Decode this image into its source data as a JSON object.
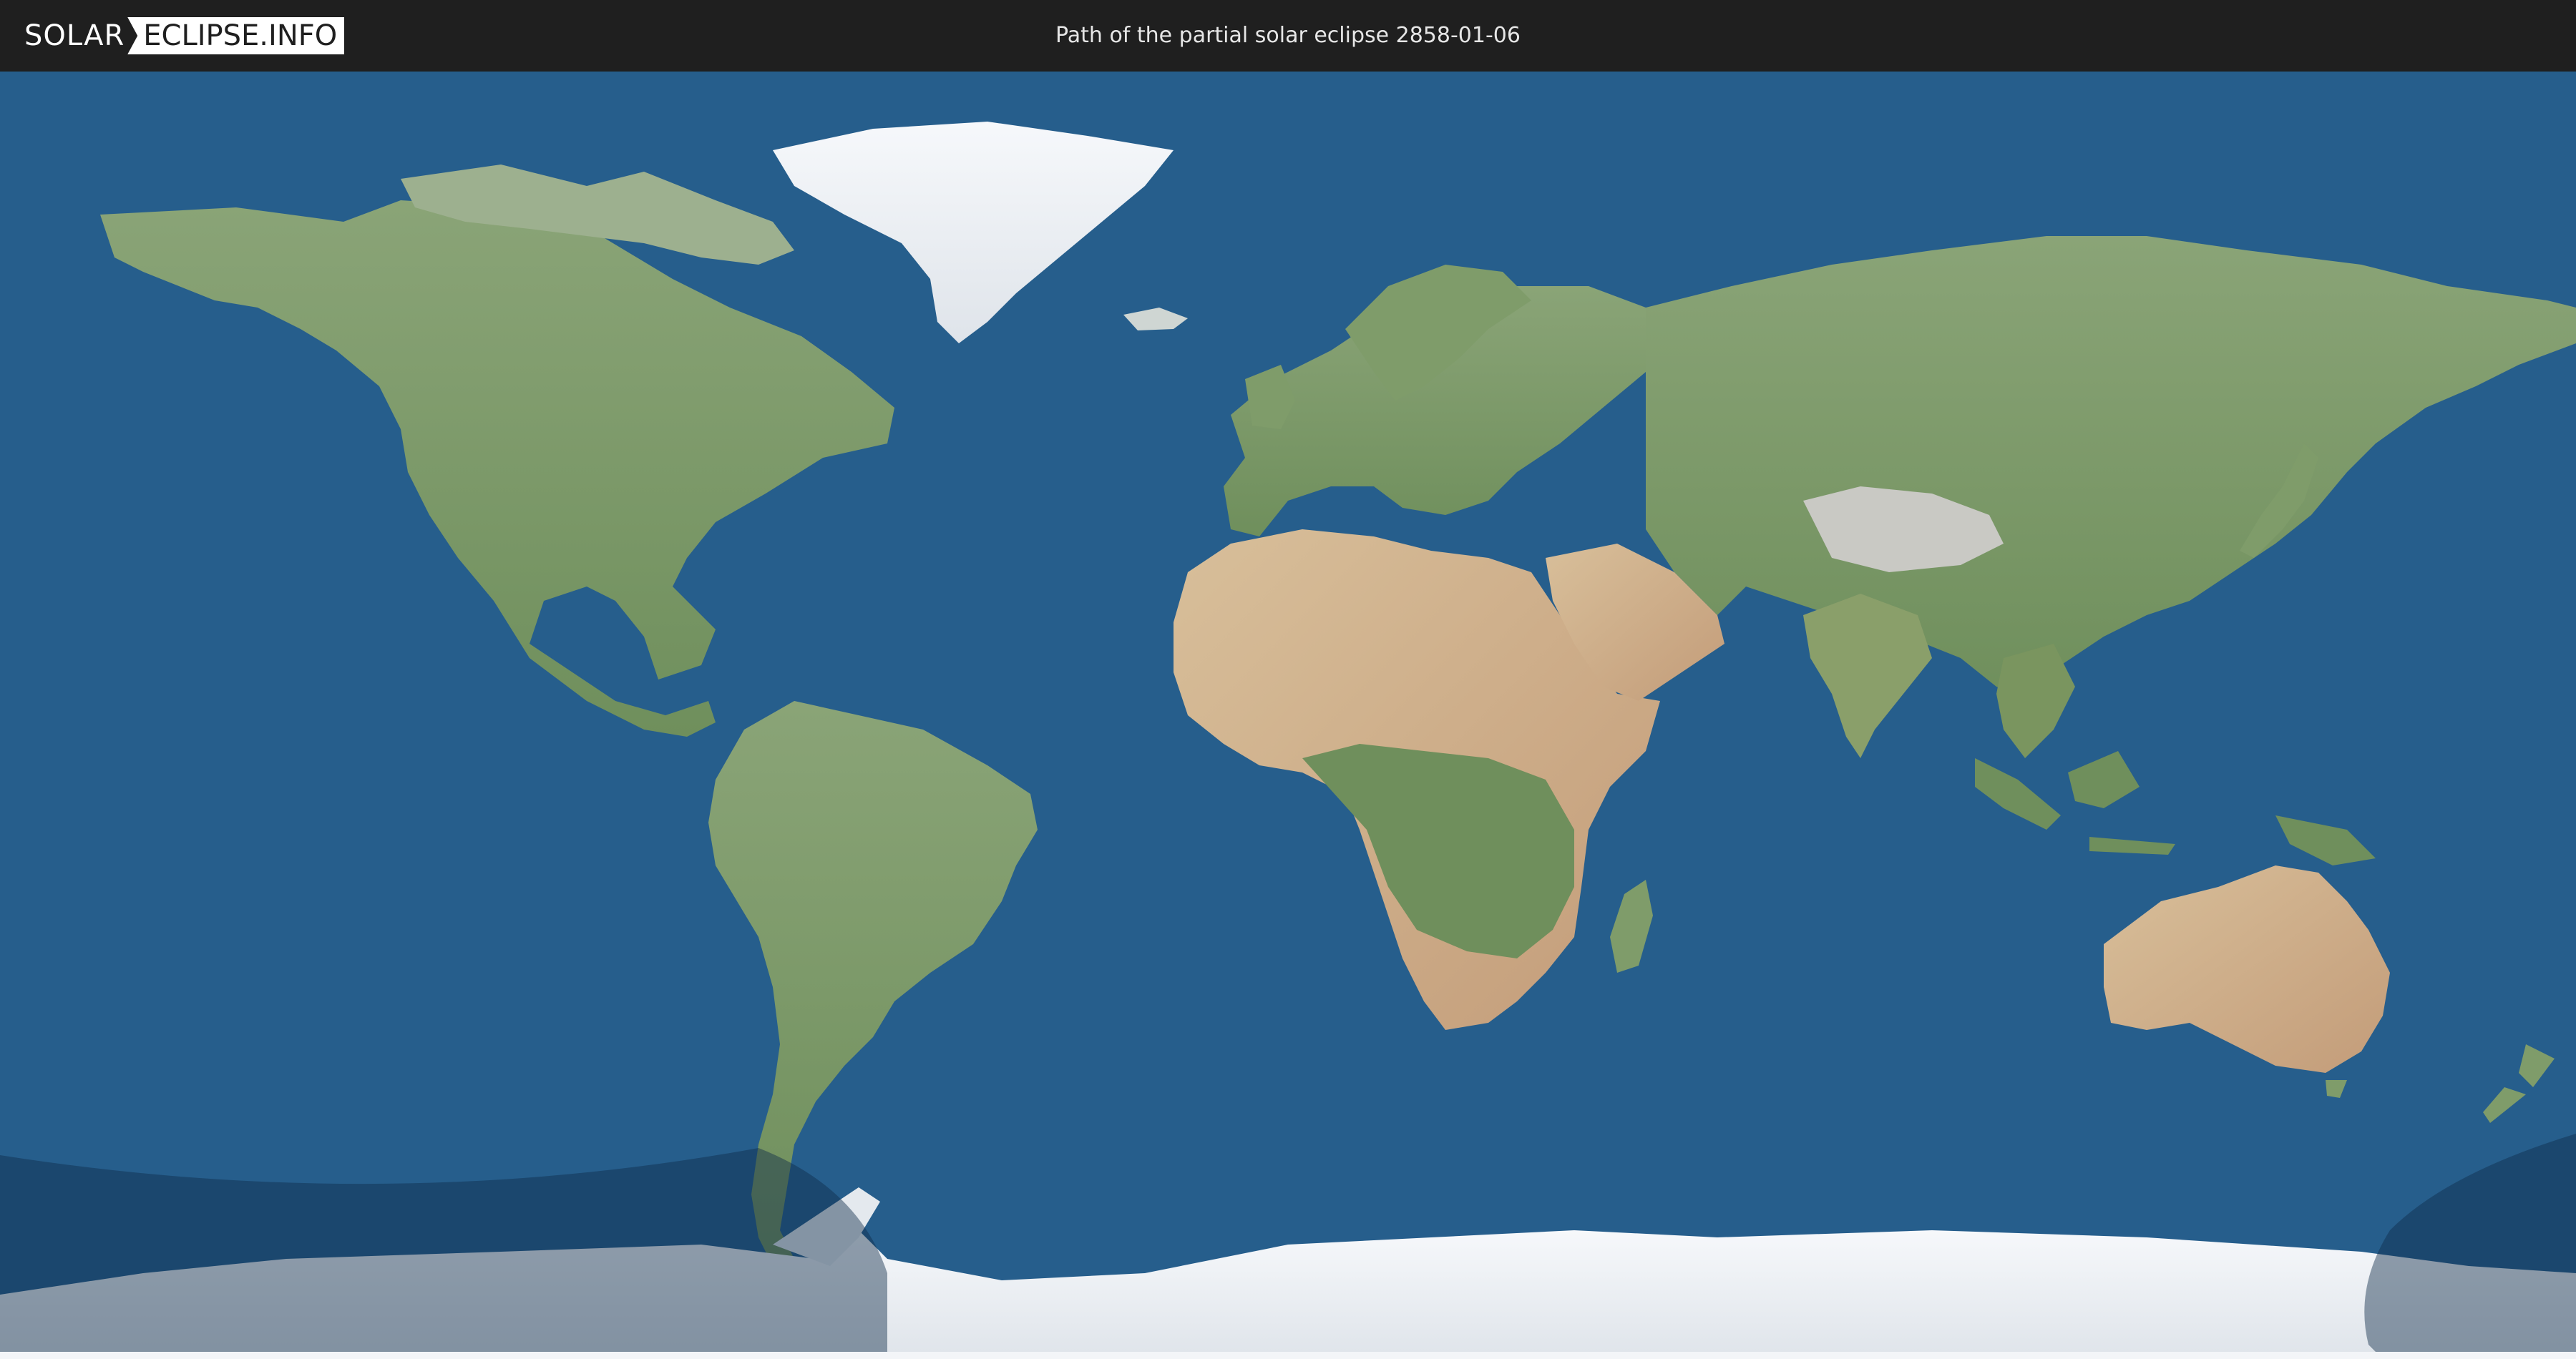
{
  "header": {
    "logo_part1": "SOLAR",
    "logo_part2": "ECLIPSE.INFO",
    "title": "Path of the partial solar eclipse 2858-01-06"
  },
  "map": {
    "projection": "equirectangular",
    "colors": {
      "ocean": "#265e8c",
      "land": "#7c9a68",
      "desert": "#c9ab86",
      "ice": "#eef1f5",
      "eclipse_shadow": "#0f2c4a"
    },
    "overlays": [
      {
        "name": "partial-eclipse-zone-west"
      },
      {
        "name": "partial-eclipse-zone-east"
      }
    ]
  }
}
